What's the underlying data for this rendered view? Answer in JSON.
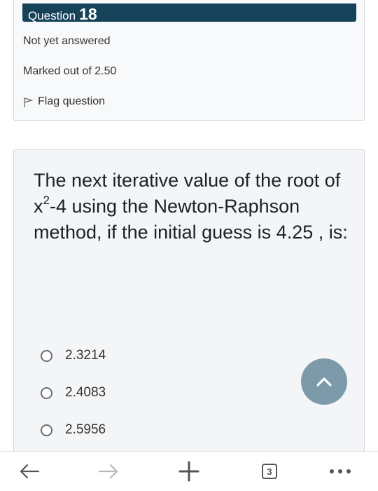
{
  "question": {
    "label": "Question",
    "number": "18",
    "state": "Not yet answered",
    "grade": "Marked out of 2.50",
    "flag_label": "Flag question"
  },
  "content": {
    "text_part1": "The next iterative value of the root of x",
    "sup": "2",
    "text_part2": "-4  using the Newton-Raphson method, if the initial guess is 4.25 , is:"
  },
  "options": [
    {
      "label": "2.3214"
    },
    {
      "label": "2.4083"
    },
    {
      "label": "2.5956"
    }
  ],
  "browser": {
    "tab_count": "3"
  },
  "icons": {
    "flag": "flag-icon",
    "scroll_top": "chevron-up-icon",
    "back": "arrow-left-icon",
    "forward": "arrow-right-icon",
    "new_tab": "plus-icon",
    "menu": "more-dots-icon"
  },
  "colors": {
    "header_bg": "#16435a",
    "scroll_button": "#7c9aaa"
  }
}
